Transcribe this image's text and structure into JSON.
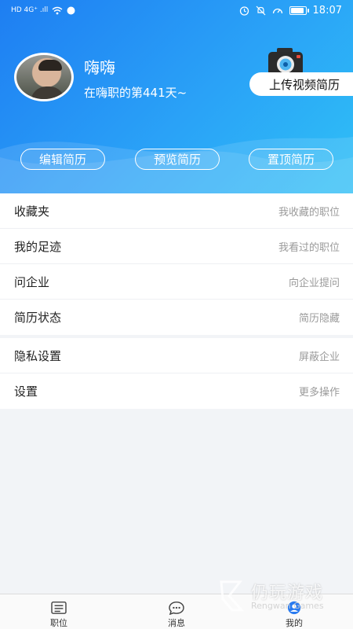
{
  "status_bar": {
    "left_indicators": "HD 4G⁺ .ıll",
    "time": "18:07"
  },
  "profile": {
    "name": "嗨嗨",
    "days_text": "在嗨职的第441天~",
    "video_resume_label": "上传视频简历"
  },
  "resume_actions": {
    "edit": "编辑简历",
    "preview": "预览简历",
    "top": "置顶简历"
  },
  "menu_group_1": [
    {
      "label": "收藏夹",
      "hint": "我收藏的职位"
    },
    {
      "label": "我的足迹",
      "hint": "我看过的职位"
    },
    {
      "label": "问企业",
      "hint": "向企业提问"
    },
    {
      "label": "简历状态",
      "hint": "简历隐藏"
    }
  ],
  "menu_group_2": [
    {
      "label": "隐私设置",
      "hint": "屏蔽企业"
    },
    {
      "label": "设置",
      "hint": "更多操作"
    }
  ],
  "tabs": [
    {
      "label": "职位",
      "icon": "job-list-icon"
    },
    {
      "label": "消息",
      "icon": "message-bubble-icon"
    },
    {
      "label": "我的",
      "icon": "profile-icon"
    }
  ],
  "watermark": {
    "title": "仍玩游戏",
    "subtitle": "Rengwan Games"
  },
  "colors": {
    "header_start": "#1e7ef2",
    "header_end": "#2fc0f6",
    "active_tab": "#2a7bf0"
  }
}
